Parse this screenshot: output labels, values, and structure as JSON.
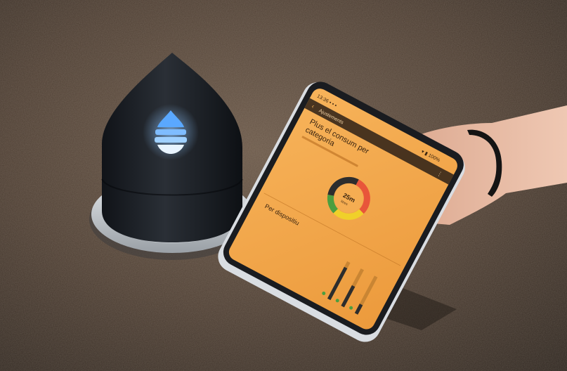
{
  "scene": {
    "subject": "drop-shaped smart speaker next to a hand holding a smartphone",
    "colors": {
      "countertop": "#5a4a3d",
      "speaker": "#1b1f24",
      "led_blue": "#5aa8ff",
      "led_white": "#e8f4ff",
      "phone_screen": "#f3a64a",
      "phone_frame": "#1a1c20",
      "phone_case": "#d9dde2",
      "skin": "#e2b49c",
      "wristband": "#141414"
    }
  },
  "phone_screen": {
    "status_left": "13:36 ▪ ▪ ▪",
    "status_right": "▾ ▮ 100%",
    "app_bar_title": "Ajustements",
    "heading_line1": "Plus el consum per",
    "heading_line2": "categoria",
    "donut_center_value": "25m",
    "donut_center_sub": "litres",
    "section2_title": "Per dispositiu",
    "donut_segments": [
      {
        "color": "#e8553a",
        "value": 0.3
      },
      {
        "color": "#f0d02a",
        "value": 0.25
      },
      {
        "color": "#4c9e3f",
        "value": 0.15
      },
      {
        "color": "#2d2d2d",
        "value": 0.3
      }
    ],
    "bars": [
      0.85,
      0.55,
      0.25
    ]
  }
}
